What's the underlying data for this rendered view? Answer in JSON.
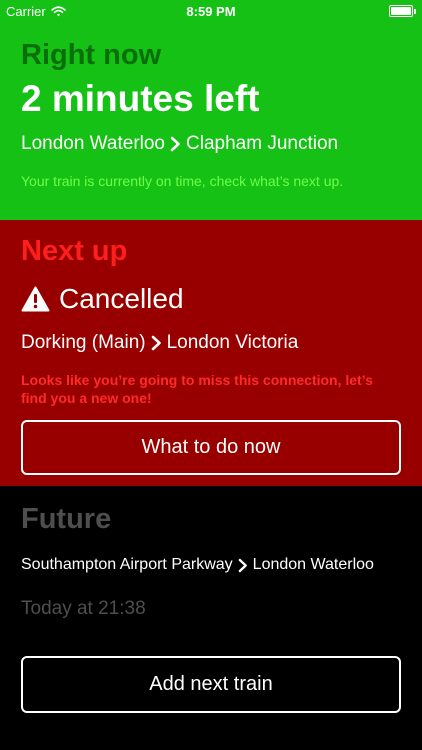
{
  "status_bar": {
    "carrier": "Carrier",
    "time": "8:59 PM"
  },
  "right_now": {
    "heading": "Right now",
    "time_left": "2 minutes left",
    "from": "London Waterloo",
    "to": "Clapham Junction",
    "note": "Your train is currently on time, check what’s next up."
  },
  "next_up": {
    "heading": "Next up",
    "status": "Cancelled",
    "from": "Dorking (Main)",
    "to": "London Victoria",
    "note": "Looks like you’re going to miss this connection, let’s find you a new one!",
    "button_label": "What to do now"
  },
  "future": {
    "heading": "Future",
    "from": "Southampton Airport Parkway",
    "to": "London Waterloo",
    "time": "Today at 21:38",
    "button_label": "Add next train"
  },
  "colors": {
    "on_time_green": "#14c114",
    "cancelled_red": "#980000",
    "future_black": "#000000"
  },
  "icons": {
    "wifi": "wifi-icon",
    "battery": "battery-icon",
    "warning": "warning-icon",
    "chevron": "chevron-right-icon"
  }
}
